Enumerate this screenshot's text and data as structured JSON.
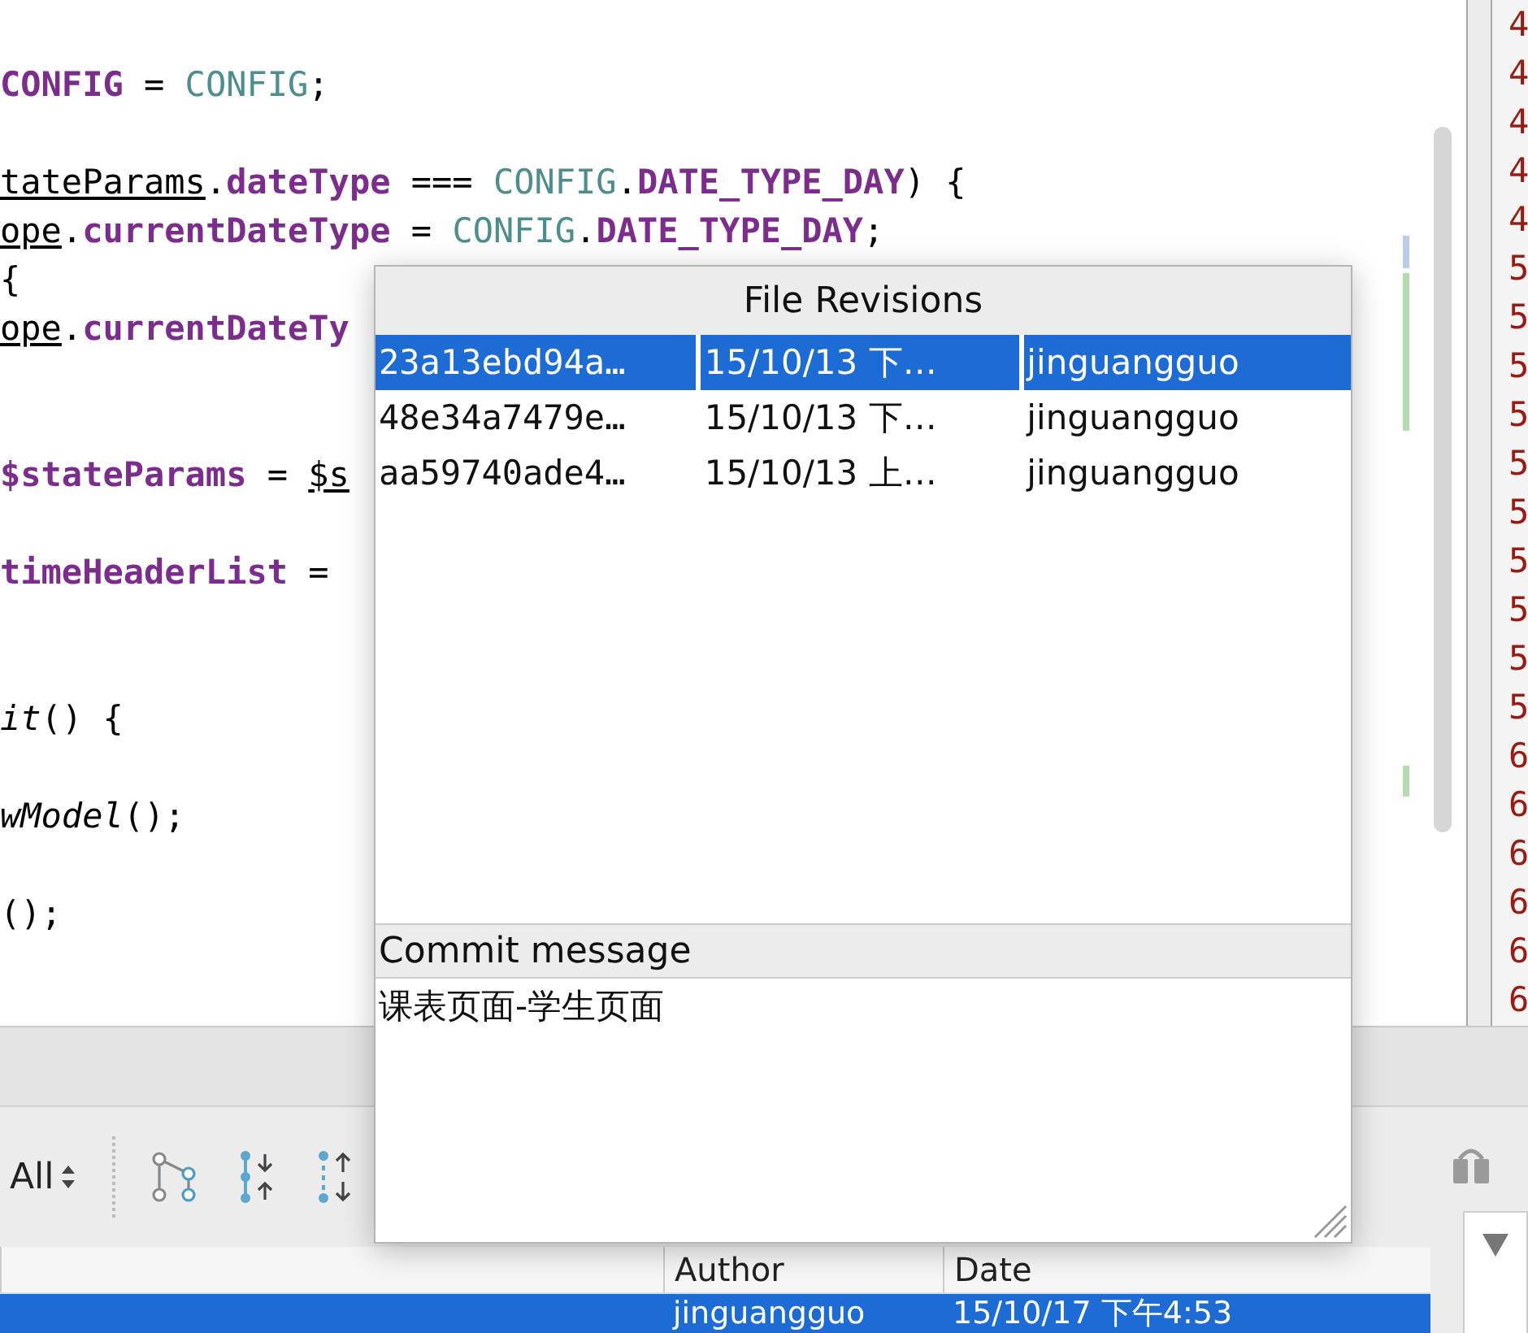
{
  "editor": {
    "lines": [
      {
        "kind": "blank"
      },
      {
        "kind": "code",
        "tokens": [
          {
            "kind": "field",
            "text": "CONFIG"
          },
          {
            "kind": "plain",
            "text": " = "
          },
          {
            "kind": "const",
            "text": "CONFIG"
          },
          {
            "kind": "plain",
            "text": ";"
          }
        ]
      },
      {
        "kind": "blank"
      },
      {
        "kind": "code",
        "tokens": [
          {
            "kind": "local",
            "text": "tateParams"
          },
          {
            "kind": "plain",
            "text": "."
          },
          {
            "kind": "field",
            "text": "dateType"
          },
          {
            "kind": "plain",
            "text": " === "
          },
          {
            "kind": "const",
            "text": "CONFIG"
          },
          {
            "kind": "plain",
            "text": "."
          },
          {
            "kind": "field",
            "text": "DATE_TYPE_DAY"
          },
          {
            "kind": "plain",
            "text": ") {"
          }
        ]
      },
      {
        "kind": "code",
        "tokens": [
          {
            "kind": "local",
            "text": "ope"
          },
          {
            "kind": "plain",
            "text": "."
          },
          {
            "kind": "field",
            "text": "currentDateType"
          },
          {
            "kind": "plain",
            "text": " = "
          },
          {
            "kind": "const",
            "text": "CONFIG"
          },
          {
            "kind": "plain",
            "text": "."
          },
          {
            "kind": "field",
            "text": "DATE_TYPE_DAY"
          },
          {
            "kind": "plain",
            "text": ";"
          }
        ]
      },
      {
        "kind": "code",
        "tokens": [
          {
            "kind": "plain",
            "text": "{"
          }
        ]
      },
      {
        "kind": "code",
        "tokens": [
          {
            "kind": "local",
            "text": "ope"
          },
          {
            "kind": "plain",
            "text": "."
          },
          {
            "kind": "field",
            "text": "currentDateTy"
          }
        ]
      },
      {
        "kind": "blank"
      },
      {
        "kind": "blank"
      },
      {
        "kind": "code",
        "tokens": [
          {
            "kind": "field",
            "text": "$stateParams"
          },
          {
            "kind": "plain",
            "text": " = "
          },
          {
            "kind": "local",
            "text": "$s"
          }
        ]
      },
      {
        "kind": "blank"
      },
      {
        "kind": "code",
        "tokens": [
          {
            "kind": "field",
            "text": "timeHeaderList"
          },
          {
            "kind": "plain",
            "text": " ="
          }
        ]
      },
      {
        "kind": "blank"
      },
      {
        "kind": "blank"
      },
      {
        "kind": "code",
        "tokens": [
          {
            "kind": "method",
            "text": "it"
          },
          {
            "kind": "plain",
            "text": "() {"
          }
        ]
      },
      {
        "kind": "blank"
      },
      {
        "kind": "code",
        "tokens": [
          {
            "kind": "method",
            "text": "wModel"
          },
          {
            "kind": "plain",
            "text": "();"
          }
        ]
      },
      {
        "kind": "blank"
      },
      {
        "kind": "code",
        "tokens": [
          {
            "kind": "plain",
            "text": "();"
          }
        ]
      }
    ]
  },
  "gutter": {
    "line_numbers": [
      "4",
      "4",
      "4",
      "4",
      "4",
      "5",
      "5",
      "5",
      "5",
      "5",
      "5",
      "5",
      "5",
      "5",
      "5",
      "6",
      "6",
      "6",
      "6",
      "6",
      "6"
    ]
  },
  "popup": {
    "title": "File Revisions",
    "revisions": [
      {
        "hash": "23a13ebd94a…",
        "date": "15/10/13 下…",
        "author": "jinguangguo",
        "selected": true
      },
      {
        "hash": "48e34a7479e…",
        "date": "15/10/13 下…",
        "author": "jinguangguo",
        "selected": false
      },
      {
        "hash": "aa59740ade4…",
        "date": "15/10/13 上…",
        "author": "jinguangguo",
        "selected": false
      }
    ],
    "commit_message_label": "Commit message",
    "commit_message": "课表页面-学生页面"
  },
  "log_panel": {
    "filter": "All",
    "columns": [
      "Author",
      "Date"
    ],
    "rows": [
      {
        "author": "jinguangguo",
        "date": "15/10/17 下午4:53",
        "selected": true
      }
    ]
  }
}
